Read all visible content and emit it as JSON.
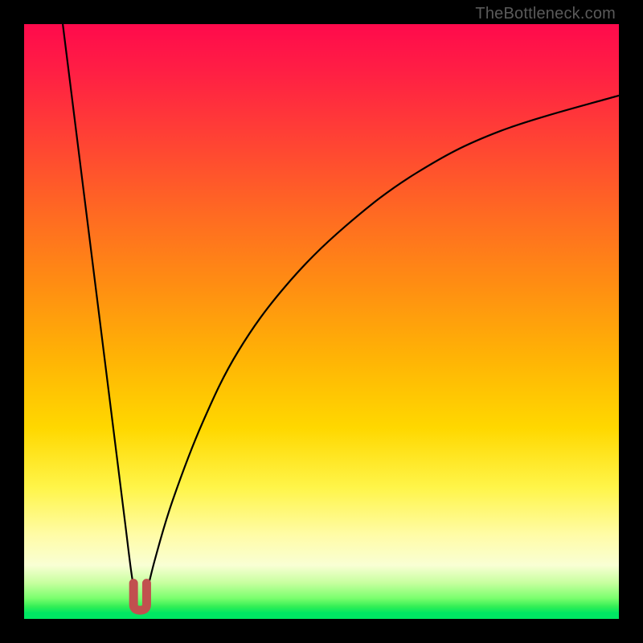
{
  "watermark": "TheBottleneck.com",
  "colors": {
    "frame": "#000000",
    "curve_stroke": "#000000",
    "marker_stroke": "#c1504f",
    "gradient_top": "#ff0a4c",
    "gradient_bottom": "#00e763"
  },
  "chart_data": {
    "type": "line",
    "title": "",
    "xlabel": "",
    "ylabel": "",
    "xlim": [
      0,
      100
    ],
    "ylim": [
      0,
      100
    ],
    "grid": false,
    "legend": null,
    "notes": "V-shaped bottleneck curve. Left branch descends steeply from (x≈6.5, y=100) to minimum. Right branch rises toward (x=100, y≈88). Minimum ('U' marker) at x≈19, y≈2. y-axis inverted visually (0 at bottom = green = good, 100 at top = red = bad).",
    "series": [
      {
        "name": "left_branch",
        "x": [
          6.5,
          8,
          10,
          12,
          14,
          16,
          17,
          18,
          18.8
        ],
        "y": [
          100,
          88,
          72,
          56,
          40,
          24,
          16,
          8,
          3
        ]
      },
      {
        "name": "right_branch",
        "x": [
          20.3,
          22,
          25,
          30,
          36,
          44,
          54,
          66,
          80,
          100
        ],
        "y": [
          3,
          10,
          20,
          33,
          45,
          56,
          66,
          75,
          82,
          88
        ]
      }
    ],
    "marker": {
      "name": "optimal-U",
      "x": 19.5,
      "y": 2,
      "width_x": 2.2,
      "height_y": 4
    }
  }
}
